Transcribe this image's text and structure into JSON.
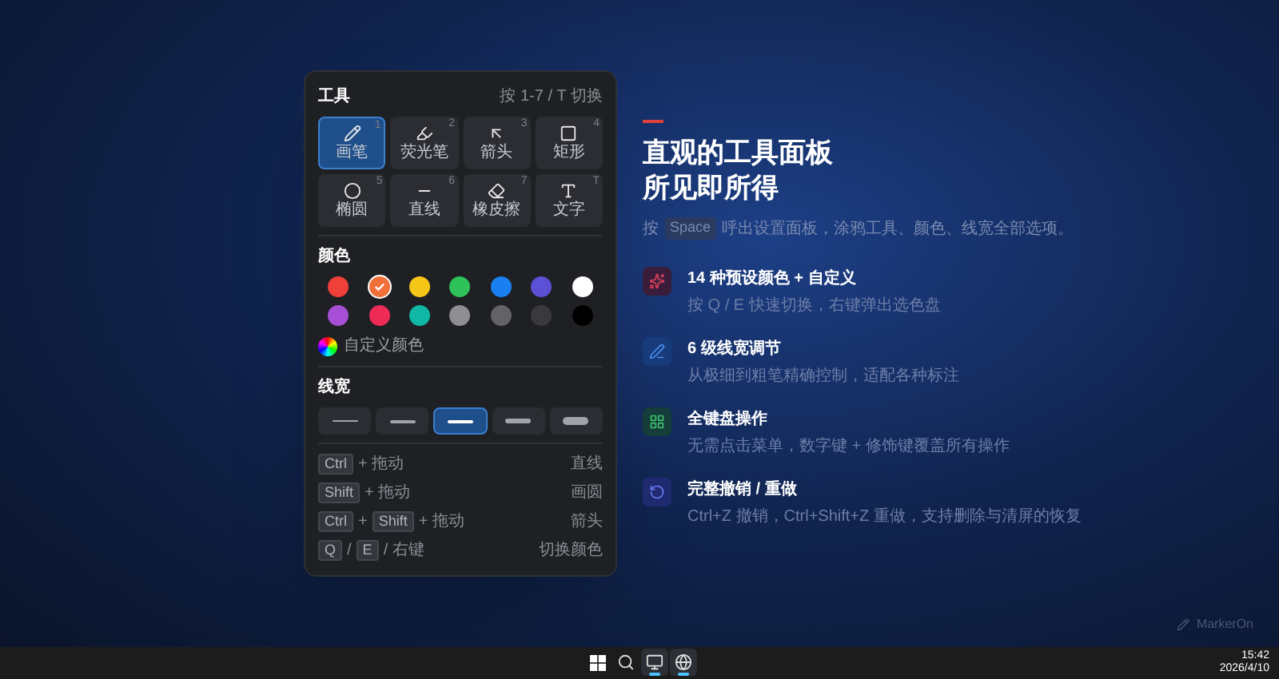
{
  "panel": {
    "title": "工具",
    "hint": "按 1-7 / T 切换",
    "tools": [
      {
        "kind": "pen",
        "label": "画笔",
        "number": "1",
        "selected": true
      },
      {
        "kind": "highlighter",
        "label": "荧光笔",
        "number": "2",
        "selected": false
      },
      {
        "kind": "arrow",
        "label": "箭头",
        "number": "3",
        "selected": false
      },
      {
        "kind": "rect",
        "label": "矩形",
        "number": "4",
        "selected": false
      },
      {
        "kind": "ellipse",
        "label": "椭圆",
        "number": "5",
        "selected": false
      },
      {
        "kind": "line",
        "label": "直线",
        "number": "6",
        "selected": false
      },
      {
        "kind": "eraser",
        "label": "橡皮擦",
        "number": "7",
        "selected": false
      },
      {
        "kind": "text",
        "label": "文字",
        "number": "T",
        "selected": false
      }
    ],
    "colors_title": "颜色",
    "colors": [
      {
        "color": "#f0403a",
        "selected": false
      },
      {
        "color": "#f0703a",
        "selected": true
      },
      {
        "color": "#f5c518",
        "selected": false
      },
      {
        "color": "#2fc15a",
        "selected": false
      },
      {
        "color": "#1a7ff0",
        "selected": false
      },
      {
        "color": "#5b50d6",
        "selected": false
      },
      {
        "color": "#ffffff",
        "selected": false
      },
      {
        "color": "#a64fd6",
        "selected": false
      },
      {
        "color": "#ee2a57",
        "selected": false
      },
      {
        "color": "#11b8a6",
        "selected": false
      },
      {
        "color": "#8e8e93",
        "selected": false
      },
      {
        "color": "#636366",
        "selected": false
      },
      {
        "color": "#3a3a3c",
        "selected": false
      },
      {
        "color": "#000000",
        "selected": false
      }
    ],
    "custom_color": "自定义颜色",
    "width_title": "线宽",
    "widths": [
      {
        "selected": false
      },
      {
        "selected": false
      },
      {
        "selected": true
      },
      {
        "selected": false
      },
      {
        "selected": false
      }
    ],
    "shortcuts": [
      {
        "parts": [
          {
            "kind": "key",
            "text": "Ctrl"
          },
          {
            "kind": "text",
            "text": "+ 拖动"
          }
        ],
        "action": "直线"
      },
      {
        "parts": [
          {
            "kind": "key",
            "text": "Shift"
          },
          {
            "kind": "text",
            "text": "+ 拖动"
          }
        ],
        "action": "画圆"
      },
      {
        "parts": [
          {
            "kind": "key",
            "text": "Ctrl"
          },
          {
            "kind": "text",
            "text": "+"
          },
          {
            "kind": "key",
            "text": "Shift"
          },
          {
            "kind": "text",
            "text": "+ 拖动"
          }
        ],
        "action": "箭头"
      },
      {
        "parts": [
          {
            "kind": "key",
            "text": "Q"
          },
          {
            "kind": "text",
            "text": "/"
          },
          {
            "kind": "key",
            "text": "E"
          },
          {
            "kind": "text",
            "text": "/ 右键"
          }
        ],
        "action": "切换颜色"
      }
    ]
  },
  "headline": [
    "直观的工具面板",
    "所见即所得"
  ],
  "subtitle": {
    "before": "按",
    "key": "Space",
    "after": "呼出设置面板，涂鸦工具、颜色、线宽全部选项。"
  },
  "features": [
    {
      "kind": "palette",
      "title": "14 种预设颜色 + 自定义",
      "text": "按 Q / E 快速切换，右键弹出选色盘"
    },
    {
      "kind": "pen",
      "title": "6 级线宽调节",
      "text": "从极细到粗笔精确控制，适配各种标注"
    },
    {
      "kind": "keyboard",
      "title": "全键盘操作",
      "text": "无需点击菜单，数字键 + 修饰键覆盖所有操作"
    },
    {
      "kind": "undo",
      "title": "完整撤销 / 重做",
      "text": "Ctrl+Z 撤销，Ctrl+Shift+Z 重做，支持删除与清屏的恢复"
    }
  ],
  "brand": "MarkerOn",
  "taskbar": {
    "items": [
      {
        "kind": "start",
        "running": false
      },
      {
        "kind": "search",
        "running": false
      },
      {
        "kind": "monitor",
        "running": true
      },
      {
        "kind": "globe",
        "running": true
      }
    ],
    "time": "15:42",
    "date": "2026/4/10"
  }
}
